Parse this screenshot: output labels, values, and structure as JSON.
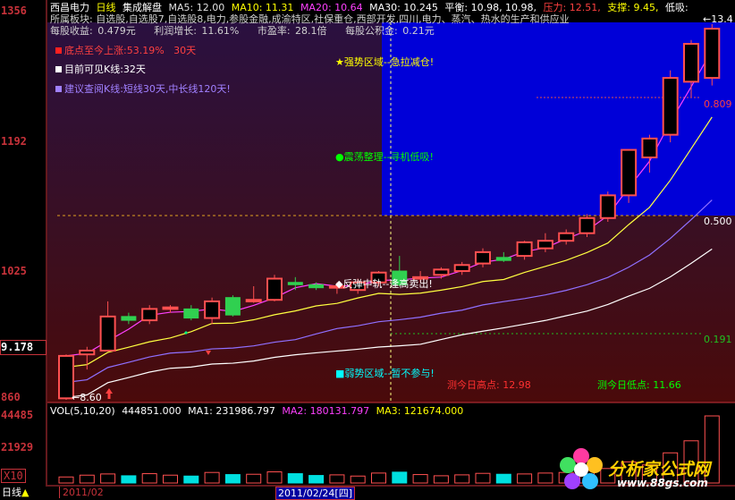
{
  "header": {
    "stock_name": "西昌电力",
    "period": "日线",
    "indicator": "集成解盘",
    "ma": [
      {
        "label": "MA5: 12.00",
        "color": "#ffffff"
      },
      {
        "label": "MA10: 11.31",
        "color": "#ffff00"
      },
      {
        "label": "MA20: 10.64",
        "color": "#ff40ff"
      },
      {
        "label": "MA30: 10.245",
        "color": "#ffffff"
      }
    ],
    "pingheng": "平衡: 10.98, 10.98,",
    "yali": "压力: 12.51,",
    "zhicheng": "支撑: 9.45,",
    "dixi": "低吸:",
    "sector": "所属板块: 自选股,自选股7,自选股8,电力,参股金融,成渝特区,社保重仓,西部开发,四川,电力、蒸汽、热水的生产和供应业",
    "eps": "每股收益: 0.479元",
    "profit_growth": "利润增长: 11.61%",
    "pe": "市盈率: 28.1倍",
    "reserve": "每股公积金: 0.21元"
  },
  "info": {
    "rise_label": "底点至今上涨:53.19%",
    "rise_days": "30天",
    "visible_k": "目前可见K线:32天",
    "advice": "建议查阅K线:短线30天,中长线120天!"
  },
  "zones": {
    "strong": "★强势区域--急拉减仓!",
    "oscillate": "●震荡整理--寻机低吸!",
    "rebound": "◆反弹中轨--逢高卖出!",
    "weak": "■弱势区域--暂不参与!"
  },
  "levels": {
    "l809": "0.809",
    "l500": "0.500",
    "l191": "0.191",
    "high_mark": "13.4",
    "low_mark": "8.60"
  },
  "forecast": {
    "high": "测今日高点: 12.98",
    "low": "测今日低点: 11.66"
  },
  "y_axis": {
    "main": [
      "1356",
      "1192",
      "1025",
      "9.178",
      "860"
    ],
    "vol": [
      "44485",
      "21929",
      "X10"
    ]
  },
  "volume": {
    "label": "VOL(5,10,20)",
    "value": "444851.000",
    "ma1": "MA1: 231986.797",
    "ma2": "MA2: 180131.797",
    "ma3": "MA3: 121674.000"
  },
  "bottom": {
    "period_label": "日线",
    "month": "2011/02",
    "cursor_date": "2011/02/24[四]"
  },
  "watermark": {
    "name": "分析家公式网",
    "url": "www.88gs.com"
  },
  "colors": {
    "up": "#ff5050",
    "down": "#00e0e0",
    "cyan": "#00ffff",
    "blue_zone": "#0000d8",
    "axis": "#c8323a"
  },
  "chart_data": {
    "type": "candlestick",
    "price_range": [
      8.6,
      13.56
    ],
    "candles": [
      {
        "o": 8.62,
        "h": 9.2,
        "l": 8.6,
        "c": 9.18
      },
      {
        "o": 9.2,
        "h": 9.3,
        "l": 9.0,
        "c": 9.25
      },
      {
        "o": 9.25,
        "h": 9.9,
        "l": 9.25,
        "c": 9.7
      },
      {
        "o": 9.7,
        "h": 9.75,
        "l": 9.6,
        "c": 9.65
      },
      {
        "o": 9.65,
        "h": 9.85,
        "l": 9.6,
        "c": 9.8
      },
      {
        "o": 9.8,
        "h": 9.85,
        "l": 9.75,
        "c": 9.82
      },
      {
        "o": 9.8,
        "h": 9.85,
        "l": 9.65,
        "c": 9.68
      },
      {
        "o": 9.68,
        "h": 9.95,
        "l": 9.6,
        "c": 9.9
      },
      {
        "o": 9.95,
        "h": 9.98,
        "l": 9.7,
        "c": 9.72
      },
      {
        "o": 9.9,
        "h": 10.1,
        "l": 9.88,
        "c": 9.92
      },
      {
        "o": 9.92,
        "h": 10.25,
        "l": 9.9,
        "c": 10.2
      },
      {
        "o": 10.15,
        "h": 10.22,
        "l": 10.05,
        "c": 10.12
      },
      {
        "o": 10.12,
        "h": 10.15,
        "l": 10.05,
        "c": 10.08
      },
      {
        "o": 10.08,
        "h": 10.15,
        "l": 10.0,
        "c": 10.1
      },
      {
        "o": 10.05,
        "h": 10.2,
        "l": 10.0,
        "c": 10.15
      },
      {
        "o": 10.15,
        "h": 10.3,
        "l": 10.1,
        "c": 10.28
      },
      {
        "o": 10.3,
        "h": 10.5,
        "l": 10.1,
        "c": 10.12
      },
      {
        "o": 10.2,
        "h": 10.3,
        "l": 10.15,
        "c": 10.22
      },
      {
        "o": 10.25,
        "h": 10.35,
        "l": 10.2,
        "c": 10.32
      },
      {
        "o": 10.3,
        "h": 10.42,
        "l": 10.25,
        "c": 10.38
      },
      {
        "o": 10.4,
        "h": 10.6,
        "l": 10.35,
        "c": 10.55
      },
      {
        "o": 10.48,
        "h": 10.55,
        "l": 10.42,
        "c": 10.44
      },
      {
        "o": 10.5,
        "h": 10.7,
        "l": 10.45,
        "c": 10.68
      },
      {
        "o": 10.6,
        "h": 10.8,
        "l": 10.55,
        "c": 10.7
      },
      {
        "o": 10.7,
        "h": 10.85,
        "l": 10.65,
        "c": 10.8
      },
      {
        "o": 10.8,
        "h": 11.05,
        "l": 10.75,
        "c": 11.0
      },
      {
        "o": 11.0,
        "h": 11.35,
        "l": 10.95,
        "c": 11.3
      },
      {
        "o": 11.3,
        "h": 11.9,
        "l": 11.2,
        "c": 11.9
      },
      {
        "o": 11.8,
        "h": 12.1,
        "l": 11.6,
        "c": 12.05
      },
      {
        "o": 12.1,
        "h": 12.95,
        "l": 12.0,
        "c": 12.85
      },
      {
        "o": 12.8,
        "h": 13.35,
        "l": 12.6,
        "c": 13.3
      },
      {
        "o": 12.85,
        "h": 13.56,
        "l": 12.75,
        "c": 13.5
      }
    ],
    "volume_range": [
      0,
      44485
    ],
    "volumes": [
      4000,
      5200,
      6000,
      4800,
      6200,
      5200,
      4600,
      7000,
      5600,
      5800,
      7400,
      6200,
      5000,
      5400,
      4600,
      6600,
      7200,
      5600,
      4800,
      5400,
      6400,
      5800,
      6000,
      6600,
      7000,
      8400,
      9600,
      14000,
      12000,
      20000,
      28000,
      44485
    ]
  }
}
